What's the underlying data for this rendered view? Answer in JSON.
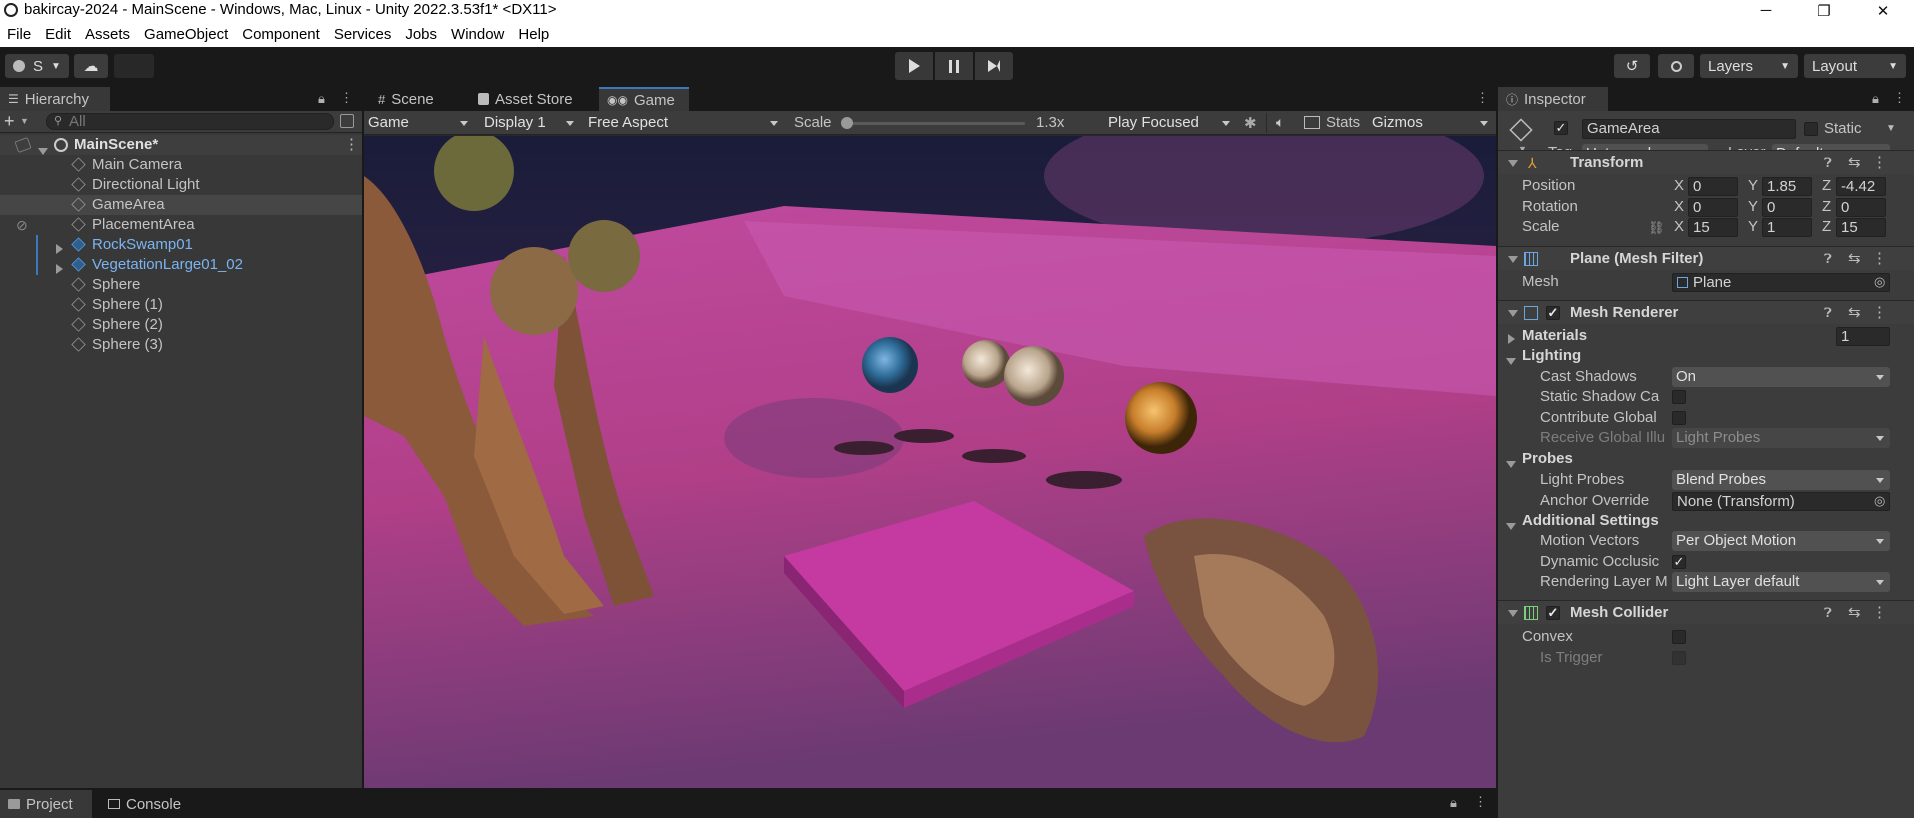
{
  "window": {
    "title": "bakircay-2024 - MainScene - Windows, Mac, Linux - Unity 2022.3.53f1* <DX11>",
    "minimize": "─",
    "restore": "❐",
    "close": "✕"
  },
  "menu": [
    "File",
    "Edit",
    "Assets",
    "GameObject",
    "Component",
    "Services",
    "Jobs",
    "Window",
    "Help"
  ],
  "toolbar": {
    "account_label": "S",
    "layers_label": "Layers",
    "layout_label": "Layout"
  },
  "hierarchy": {
    "tab": "Hierarchy",
    "search_placeholder": "All",
    "scene": "MainScene*",
    "items": [
      {
        "label": "Main Camera",
        "prefab": false,
        "expandable": false
      },
      {
        "label": "Directional Light",
        "prefab": false,
        "expandable": false
      },
      {
        "label": "GameArea",
        "prefab": false,
        "expandable": false,
        "selected": true
      },
      {
        "label": "PlacementArea",
        "prefab": false,
        "expandable": false
      },
      {
        "label": "RockSwamp01",
        "prefab": true,
        "expandable": true
      },
      {
        "label": "VegetationLarge01_02",
        "prefab": true,
        "expandable": true
      },
      {
        "label": "Sphere",
        "prefab": false,
        "expandable": false
      },
      {
        "label": "Sphere (1)",
        "prefab": false,
        "expandable": false
      },
      {
        "label": "Sphere (2)",
        "prefab": false,
        "expandable": false
      },
      {
        "label": "Sphere (3)",
        "prefab": false,
        "expandable": false
      }
    ]
  },
  "center": {
    "tabs": [
      {
        "label": "Scene",
        "icon": "grid-icon"
      },
      {
        "label": "Asset Store",
        "icon": "bag-icon"
      },
      {
        "label": "Game",
        "icon": "gamepad-icon",
        "active": true
      }
    ],
    "game_toolbar": {
      "mode": "Game",
      "display": "Display 1",
      "aspect": "Free Aspect",
      "scale_label": "Scale",
      "scale_value": "1.3x",
      "play_mode": "Play Focused",
      "stats": "Stats",
      "gizmos": "Gizmos"
    }
  },
  "inspector": {
    "tab": "Inspector",
    "object_name": "GameArea",
    "static_label": "Static",
    "tag_label": "Tag",
    "tag_value": "Untagged",
    "layer_label": "Layer",
    "layer_value": "Default",
    "transform": {
      "title": "Transform",
      "position_label": "Position",
      "rotation_label": "Rotation",
      "scale_label": "Scale",
      "position": {
        "x": "0",
        "y": "1.85",
        "z": "-4.42"
      },
      "rotation": {
        "x": "0",
        "y": "0",
        "z": "0"
      },
      "scale": {
        "x": "15",
        "y": "1",
        "z": "15"
      }
    },
    "mesh_filter": {
      "title": "Plane (Mesh Filter)",
      "mesh_label": "Mesh",
      "mesh_value": "Plane"
    },
    "mesh_renderer": {
      "title": "Mesh Renderer",
      "materials_label": "Materials",
      "materials_count": "1",
      "lighting_label": "Lighting",
      "cast_shadows_label": "Cast Shadows",
      "cast_shadows_value": "On",
      "static_shadow_label": "Static Shadow Ca",
      "contribute_gi_label": "Contribute Global",
      "receive_gi_label": "Receive Global Illu",
      "receive_gi_value": "Light Probes",
      "probes_label": "Probes",
      "light_probes_label": "Light Probes",
      "light_probes_value": "Blend Probes",
      "anchor_override_label": "Anchor Override",
      "anchor_override_value": "None (Transform)",
      "additional_label": "Additional Settings",
      "motion_vectors_label": "Motion Vectors",
      "motion_vectors_value": "Per Object Motion",
      "dynamic_occlusion_label": "Dynamic Occlusic",
      "rendering_layer_label": "Rendering Layer M",
      "rendering_layer_value": "Light Layer default"
    },
    "mesh_collider": {
      "title": "Mesh Collider",
      "convex_label": "Convex",
      "is_trigger_label": "Is Trigger"
    }
  },
  "bottom": {
    "tabs": [
      {
        "label": "Project",
        "icon": "folder-icon",
        "active": true
      },
      {
        "label": "Console",
        "icon": "console-icon"
      }
    ]
  },
  "colors": {
    "accent": "#3a79bb",
    "prefab_text": "#7cb4f0",
    "selected_row": "#2c5d87"
  }
}
